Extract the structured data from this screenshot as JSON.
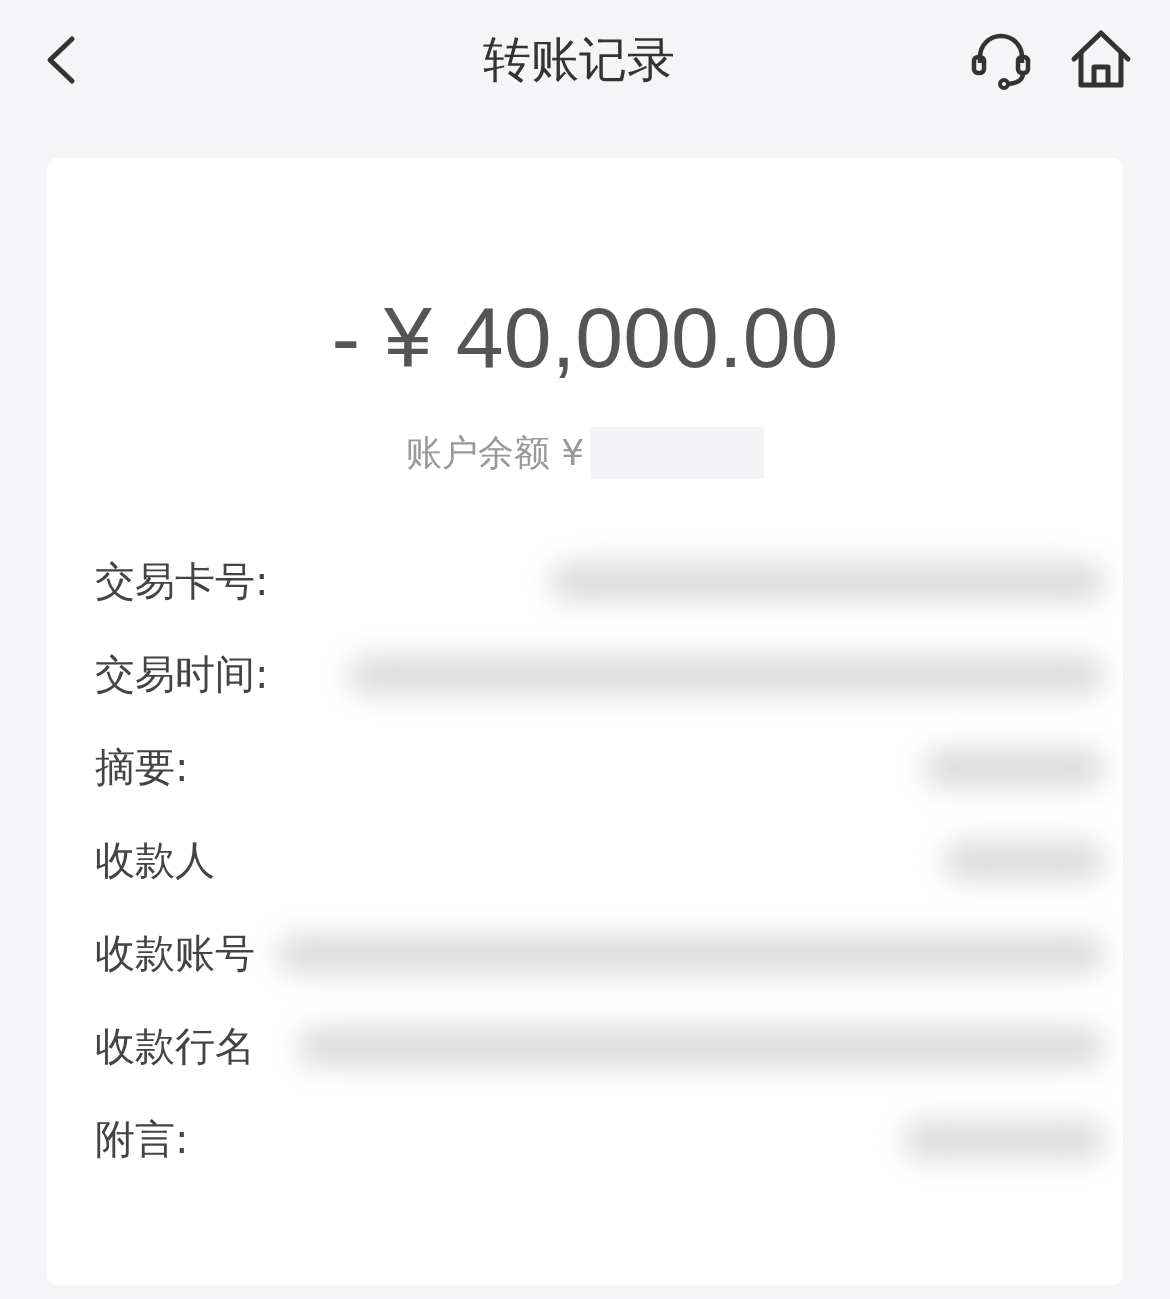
{
  "header": {
    "title": "转账记录"
  },
  "amount": "- ¥ 40,000.00",
  "balance_label": "账户余额 ¥",
  "details": [
    {
      "label": "交易卡号:"
    },
    {
      "label": "交易时间:"
    },
    {
      "label": "摘要:"
    },
    {
      "label": "收款人"
    },
    {
      "label": "收款账号"
    },
    {
      "label": "收款行名"
    },
    {
      "label": "附言:"
    }
  ]
}
